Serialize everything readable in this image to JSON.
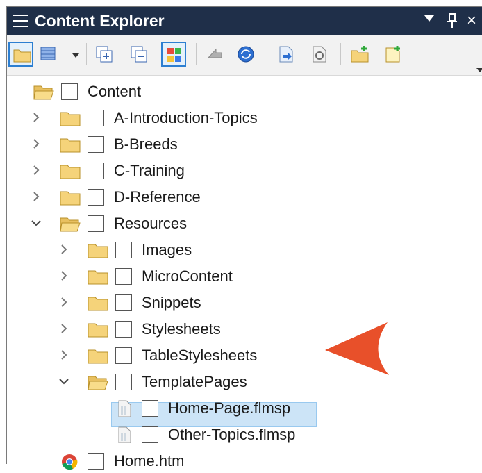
{
  "window": {
    "title": "Content Explorer"
  },
  "toolbar": {
    "buttons": [
      {
        "name": "open-folder-button",
        "icon": "folder-icon"
      },
      {
        "name": "view-options-button",
        "icon": "grid-icon"
      },
      {
        "name": "expand-all-button",
        "icon": "expand-all-icon"
      },
      {
        "name": "collapse-all-button",
        "icon": "collapse-all-icon"
      },
      {
        "name": "color-view-button",
        "icon": "color-grid-icon"
      },
      {
        "name": "back-button",
        "icon": "arrow-icon"
      },
      {
        "name": "refresh-button",
        "icon": "sync-icon"
      },
      {
        "name": "open-file-button",
        "icon": "file-open-icon"
      },
      {
        "name": "properties-button",
        "icon": "file-properties-icon"
      },
      {
        "name": "new-folder-button",
        "icon": "new-folder-icon"
      },
      {
        "name": "new-file-button",
        "icon": "new-file-icon"
      }
    ]
  },
  "tree": {
    "items": [
      {
        "label": "Content",
        "level": 0,
        "expanded": true,
        "type": "folder"
      },
      {
        "label": "A-Introduction-Topics",
        "level": 1,
        "expanded": false,
        "type": "folder"
      },
      {
        "label": "B-Breeds",
        "level": 1,
        "expanded": false,
        "type": "folder"
      },
      {
        "label": "C-Training",
        "level": 1,
        "expanded": false,
        "type": "folder"
      },
      {
        "label": "D-Reference",
        "level": 1,
        "expanded": false,
        "type": "folder"
      },
      {
        "label": "Resources",
        "level": 1,
        "expanded": true,
        "type": "folder"
      },
      {
        "label": "Images",
        "level": 2,
        "expanded": false,
        "type": "folder"
      },
      {
        "label": "MicroContent",
        "level": 2,
        "expanded": false,
        "type": "folder"
      },
      {
        "label": "Snippets",
        "level": 2,
        "expanded": false,
        "type": "folder"
      },
      {
        "label": "Stylesheets",
        "level": 2,
        "expanded": false,
        "type": "folder"
      },
      {
        "label": "TableStylesheets",
        "level": 2,
        "expanded": false,
        "type": "folder"
      },
      {
        "label": "TemplatePages",
        "level": 2,
        "expanded": true,
        "type": "folder"
      },
      {
        "label": "Home-Page.flmsp",
        "level": 3,
        "type": "file"
      },
      {
        "label": "Other-Topics.flmsp",
        "level": 3,
        "type": "file",
        "selected": true
      },
      {
        "label": "Home.htm",
        "level": 1,
        "type": "htm"
      }
    ]
  },
  "colors": {
    "titlebar": "#1f2f49",
    "selection": "#cce4f7",
    "callout_arrow": "#e8502a",
    "folder": "#f5d37a"
  }
}
